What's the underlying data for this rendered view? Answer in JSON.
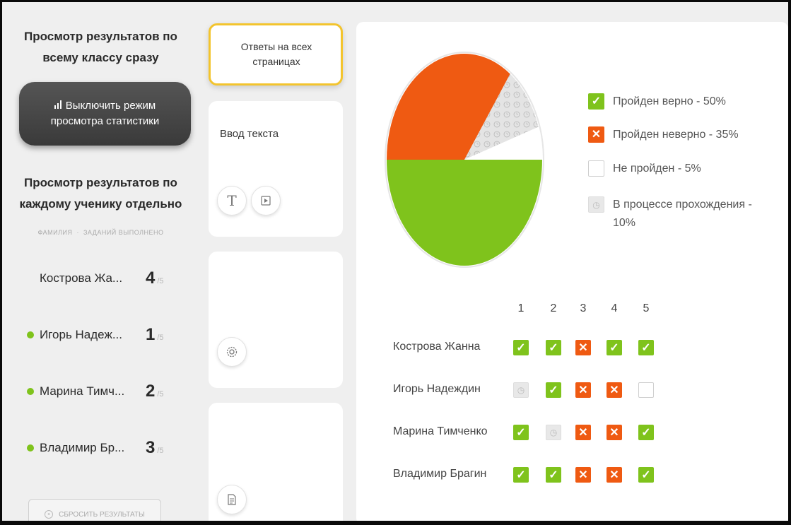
{
  "sidebar": {
    "heading_class": "Просмотр результатов по всему классу сразу",
    "stats_button": "Выключить режим просмотра статистики",
    "heading_students": "Просмотр результатов по каждому ученику отдельно",
    "col_surname": "ФАМИЛИЯ",
    "col_done": "ЗАДАНИЙ ВЫПОЛНЕНО",
    "students": [
      {
        "name": "Кострова Жа...",
        "score": "4",
        "total": "/5",
        "online": false
      },
      {
        "name": "Игорь Надеж...",
        "score": "1",
        "total": "/5",
        "online": true
      },
      {
        "name": "Марина Тимч...",
        "score": "2",
        "total": "/5",
        "online": true
      },
      {
        "name": "Владимир Бр...",
        "score": "3",
        "total": "/5",
        "online": true
      }
    ],
    "reset_button": "СБРОСИТЬ РЕЗУЛЬТАТЫ"
  },
  "middle": {
    "card_answers": "Ответы на всех страницах",
    "card_text_input": "Ввод текста",
    "icons": [
      "text-icon",
      "video-icon",
      "gear-icon",
      "document-icon"
    ]
  },
  "legend": {
    "correct": "Пройден верно - 50%",
    "incorrect": "Пройден неверно - 35%",
    "not_passed": "Не пройден - 5%",
    "in_progress": "В процессе прохождения - 10%"
  },
  "chart_data": {
    "type": "pie",
    "slices": [
      {
        "label": "Пройден верно",
        "value": 50,
        "color": "#7fc31c"
      },
      {
        "label": "Пройден неверно",
        "value": 35,
        "color": "#ef5a12"
      },
      {
        "label": "В процессе прохождения",
        "value": 10,
        "color": "#e2e2e2"
      },
      {
        "label": "Не пройден",
        "value": 5,
        "color": "#ffffff"
      }
    ]
  },
  "results": {
    "columns": [
      "1",
      "2",
      "3",
      "4",
      "5"
    ],
    "rows": [
      {
        "name": "Кострова Жанна",
        "cells": [
          "correct",
          "correct",
          "incorrect",
          "correct",
          "correct"
        ]
      },
      {
        "name": "Игорь Надеждин",
        "cells": [
          "progress",
          "correct",
          "incorrect",
          "incorrect",
          "empty"
        ]
      },
      {
        "name": "Марина Тимченко",
        "cells": [
          "correct",
          "progress",
          "incorrect",
          "incorrect",
          "correct"
        ]
      },
      {
        "name": "Владимир Брагин",
        "cells": [
          "correct",
          "correct",
          "incorrect",
          "incorrect",
          "correct"
        ]
      }
    ]
  },
  "colors": {
    "correct": "#7fc31c",
    "incorrect": "#ef5a12",
    "highlight": "#f3c42d",
    "dark_button": "#444444"
  }
}
